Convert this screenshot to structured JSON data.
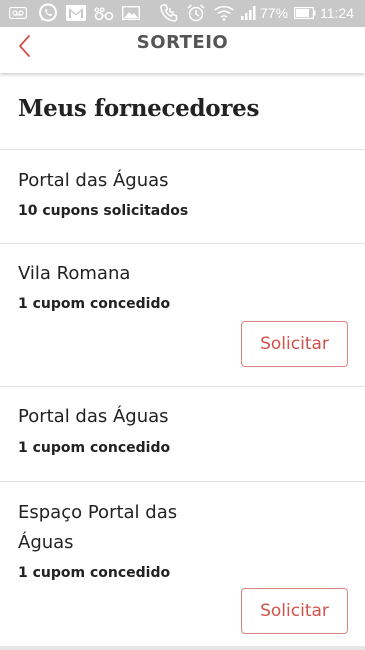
{
  "status_bar": {
    "battery_percent": "77%",
    "time": "11:24",
    "icons": [
      "voicemail-icon",
      "whatsapp-icon",
      "gmail-icon",
      "flickr-icon",
      "image-icon",
      "phone-call-icon",
      "alarm-icon",
      "wifi-icon",
      "signal-icon",
      "battery-icon"
    ]
  },
  "app_bar": {
    "title": "SORTEIO",
    "back_icon": "chevron-left-icon"
  },
  "page": {
    "title": "Meus fornecedores"
  },
  "suppliers": [
    {
      "name": "Portal das Águas",
      "status": "10 cupons solicitados",
      "action": ""
    },
    {
      "name": "Vila Romana",
      "status": "1 cupom concedido",
      "action": "Solicitar"
    },
    {
      "name": "Portal das Águas",
      "status": "1 cupom concedido",
      "action": ""
    },
    {
      "name": "Espaço Portal das Águas",
      "status": "1 cupom concedido",
      "action": "Solicitar"
    }
  ],
  "colors": {
    "accent": "#d0524a",
    "status_bar": "#c8c8c8",
    "text": "#222222",
    "app_title": "#555555"
  }
}
